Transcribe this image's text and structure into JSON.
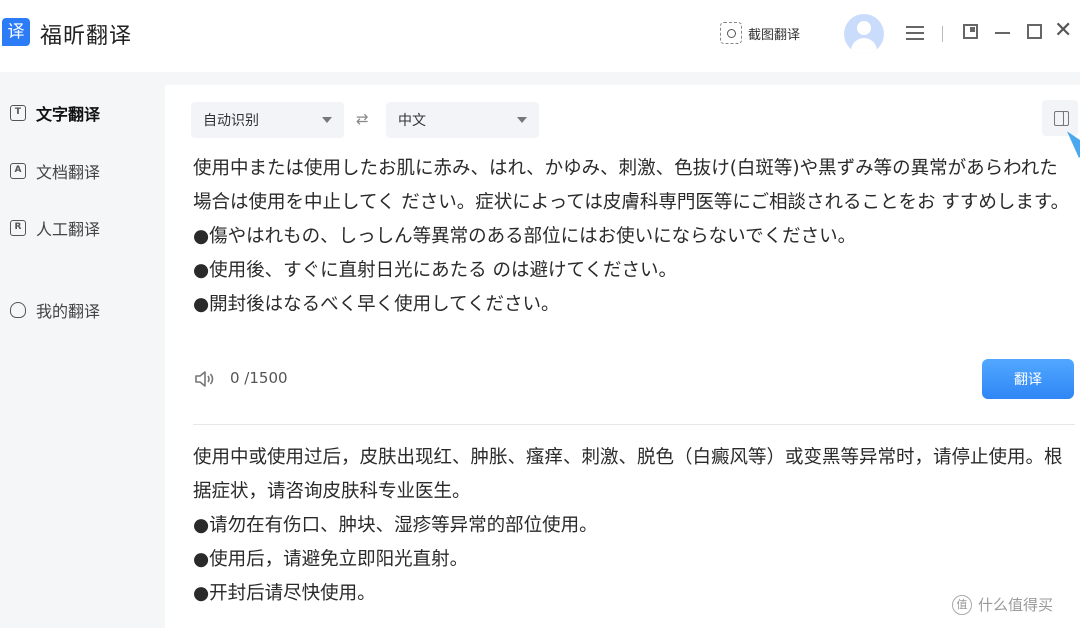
{
  "app": {
    "logo_char": "译",
    "title": "福昕翻译"
  },
  "header": {
    "screenshot_label": "截图翻译"
  },
  "sidebar": {
    "items": [
      {
        "label": "文字翻译",
        "icon": "text-icon",
        "icon_char": "T",
        "active": true
      },
      {
        "label": "文档翻译",
        "icon": "document-icon",
        "icon_char": "A",
        "active": false
      },
      {
        "label": "人工翻译",
        "icon": "human-translate-icon",
        "icon_char": "R",
        "active": false
      },
      {
        "label": "我的翻译",
        "icon": "user-icon",
        "icon_char": "",
        "active": false
      }
    ]
  },
  "translator": {
    "source_lang": "自动识别",
    "swap_symbol": "⇄",
    "target_lang": "中文",
    "source_text": "使用中または使用したお肌に赤み、はれ、かゆみ、刺激、色抜け(白斑等)や黒ずみ等の異常があらわれた場合は使用を中止してく ださい。症状によっては皮膚科専門医等にご相談されることをお すすめします。\n●傷やはれもの、しっしん等異常のある部位にはお使いにならないでください。\n●使用後、すぐに直射日光にあたる のは避けてください。\n●開封後はなるべく早く使用してください。",
    "char_count": "0 /1500",
    "translate_button": "翻译",
    "target_text": "使用中或使用过后，皮肤出现红、肿胀、瘙痒、刺激、脱色（白癜风等）或变黑等异常时，请停止使用。根据症状，请咨询皮肤科专业医生。\n●请勿在有伤口、肿块、湿疹等异常的部位使用。\n●使用后，请避免立即阳光直射。\n●开封后请尽快使用。"
  },
  "watermark": {
    "text": "什么值得买",
    "icon_char": "值"
  },
  "colors": {
    "accent": "#2f86f5",
    "sidebar_bg": "#f4f6f8",
    "select_bg": "#f2f4f7"
  }
}
